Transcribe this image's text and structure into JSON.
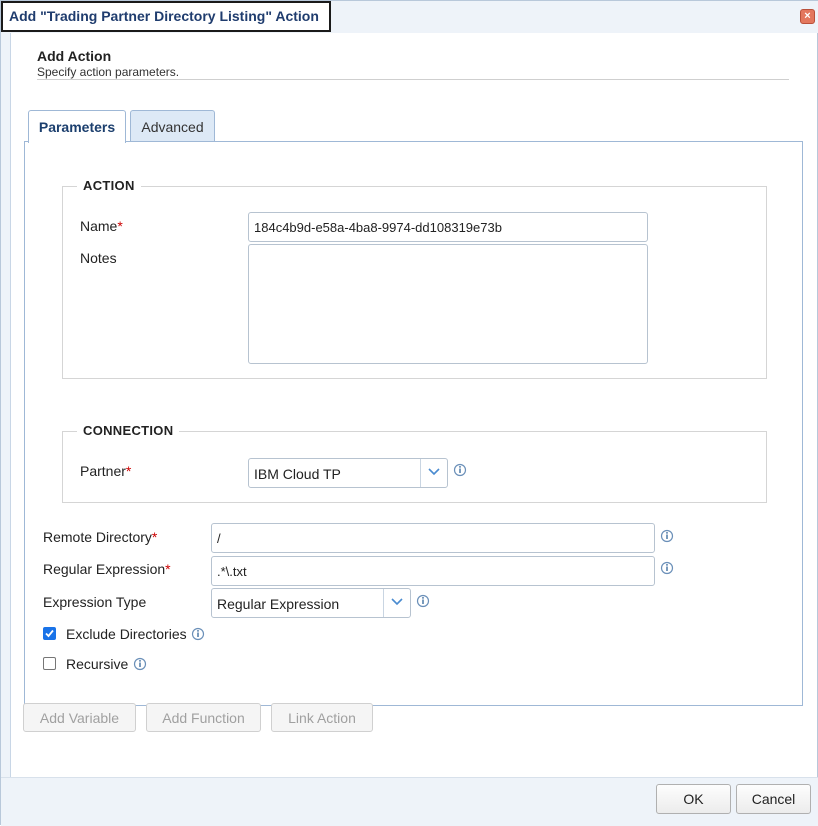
{
  "window": {
    "title": "Add \"Trading Partner Directory Listing\" Action",
    "close_glyph": "×"
  },
  "header": {
    "title": "Add Action",
    "subtitle": "Specify action parameters."
  },
  "tabs": [
    {
      "label": "Parameters",
      "active": true
    },
    {
      "label": "Advanced",
      "active": false
    }
  ],
  "action_group": {
    "legend": "ACTION",
    "name_label": "Name",
    "name_value": "184c4b9d-e58a-4ba8-9974-dd108319e73b",
    "notes_label": "Notes",
    "notes_value": ""
  },
  "connection_group": {
    "legend": "CONNECTION",
    "partner_label": "Partner",
    "partner_value": "IBM Cloud TP"
  },
  "fields": {
    "remote_directory_label": "Remote Directory",
    "remote_directory_value": "/",
    "regex_label": "Regular Expression",
    "regex_value": ".*\\.txt",
    "expression_type_label": "Expression Type",
    "expression_type_value": "Regular Expression",
    "exclude_directories_label": "Exclude Directories",
    "exclude_directories_checked": true,
    "recursive_label": "Recursive",
    "recursive_checked": false
  },
  "required_marker": "*",
  "actions": {
    "add_variable": "Add Variable",
    "add_function": "Add Function",
    "link_action": "Link Action"
  },
  "footer": {
    "ok": "OK",
    "cancel": "Cancel"
  },
  "colors": {
    "accent": "#1c3f6e",
    "required": "#cc0000",
    "checkbox": "#1a73e8",
    "close": "#e3775e"
  }
}
